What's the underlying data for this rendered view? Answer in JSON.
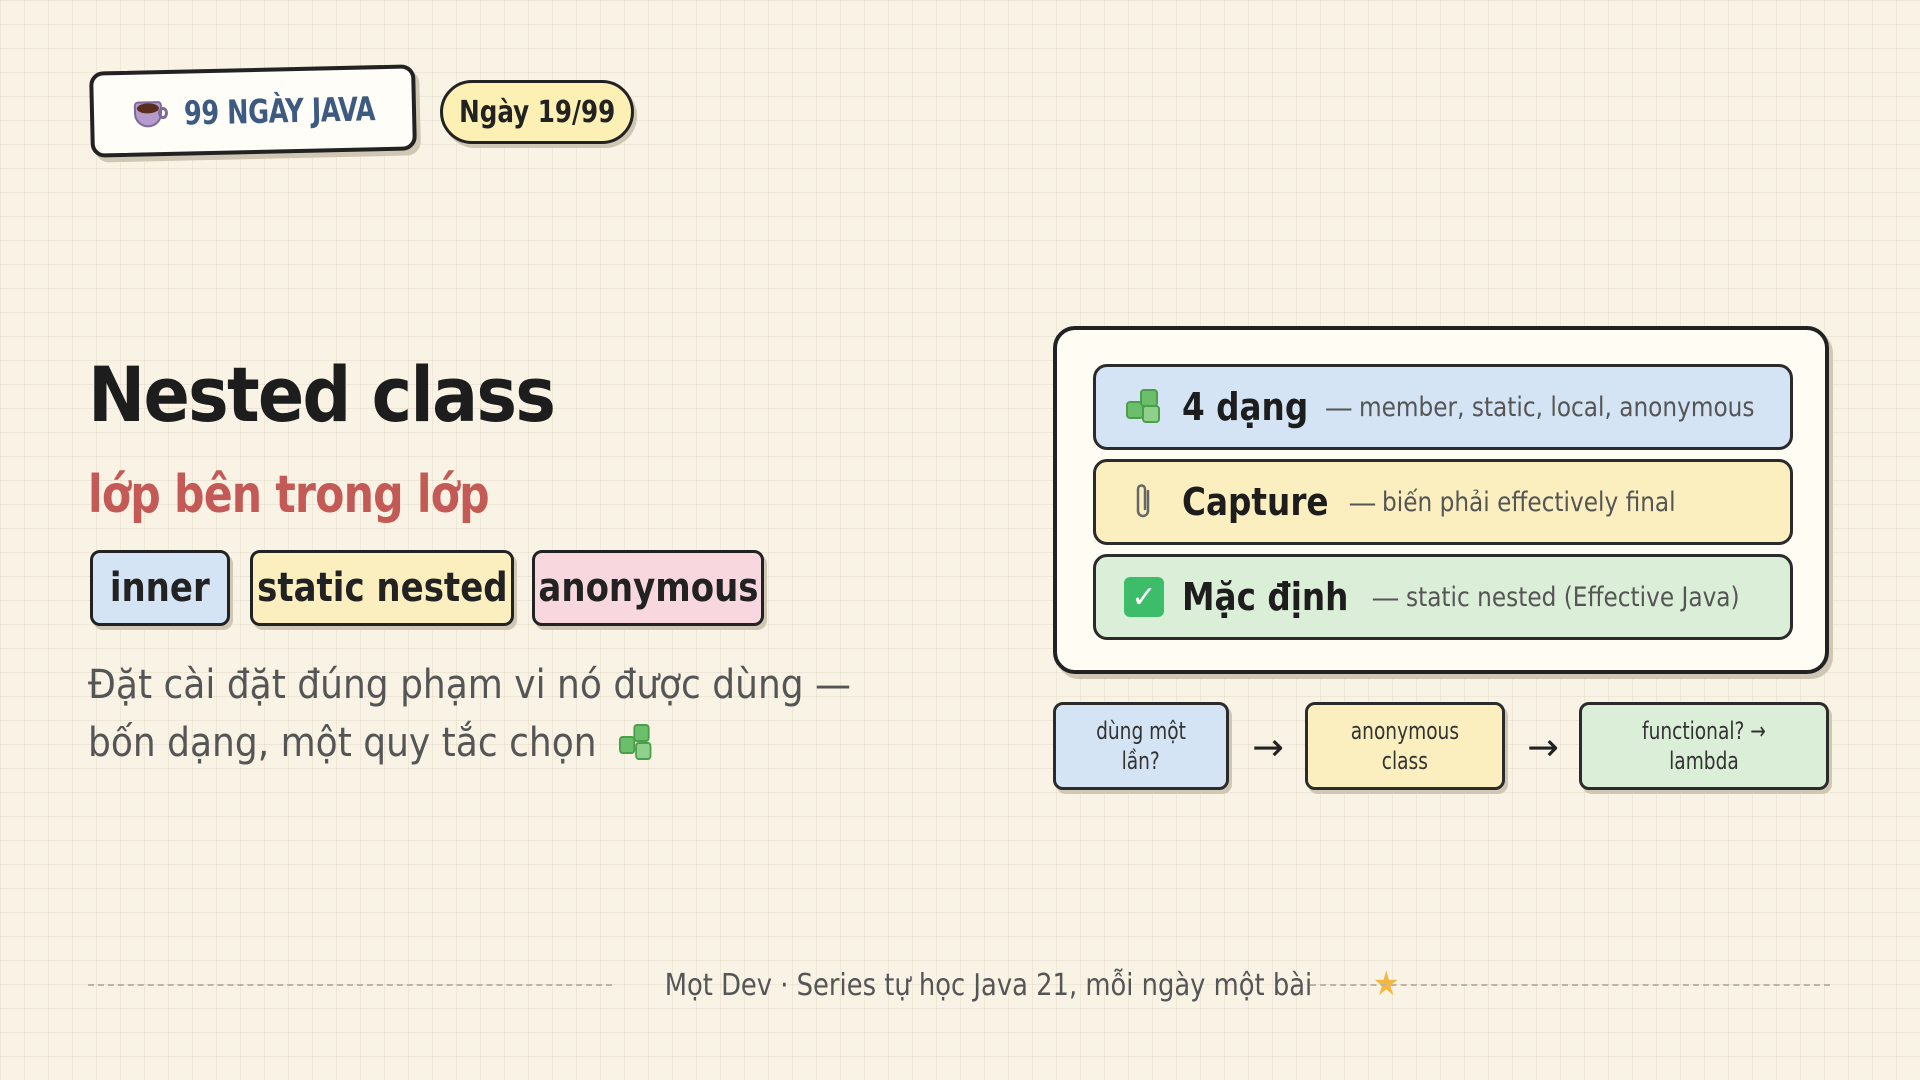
{
  "header": {
    "brand": "99 NGÀY JAVA",
    "brand_icon": "coffee-cup-icon",
    "day": "Ngày 19/99"
  },
  "main": {
    "title": "Nested class",
    "subtitle": "lớp bên trong lớp",
    "tags": [
      {
        "label": "inner",
        "color": "#d4e4f4"
      },
      {
        "label": "static nested",
        "color": "#fbefbf"
      },
      {
        "label": "anonymous",
        "color": "#f8d7de"
      }
    ],
    "description": "Đặt cài đặt đúng phạm vi nó được dùng — bốn dạng, một quy tắc chọn",
    "description_icon": "puzzle-piece-icon"
  },
  "card": {
    "rows": [
      {
        "icon": "puzzle-piece-icon",
        "label": "4 dạng",
        "separator": "—",
        "detail": "member, static, local, anonymous",
        "color": "#d4e4f4"
      },
      {
        "icon": "paperclip-icon",
        "label": "Capture",
        "separator": "—",
        "detail": "biến phải effectively final",
        "color": "#fbefbf"
      },
      {
        "icon": "check-mark-icon",
        "label": "Mặc định",
        "separator": "—",
        "detail": "static nested (Effective Java)",
        "color": "#dbeed8"
      }
    ]
  },
  "flow": {
    "steps": [
      {
        "line1": "dùng một",
        "line2": "lần?"
      },
      {
        "line1": "anonymous",
        "line2": "class"
      },
      {
        "line1": "functional? →",
        "line2": "lambda"
      }
    ],
    "arrow": "→"
  },
  "footer": {
    "text": "Mọt Dev · Series tự học Java 21, mỗi ngày một bài",
    "icon": "star-icon"
  }
}
